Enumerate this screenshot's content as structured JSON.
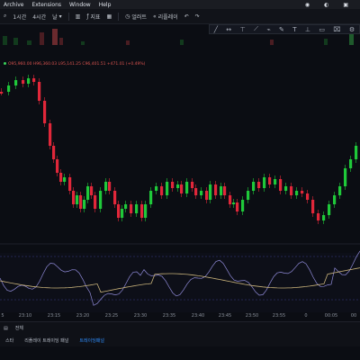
{
  "menubar": {
    "items": [
      "Archive",
      "Extensions",
      "Window",
      "Help"
    ]
  },
  "toolbar": {
    "interval": "1시간",
    "timeframe": "4시간",
    "chart_type": "날",
    "indicators": "지표",
    "alert": "얼러트",
    "replay": "리플레이"
  },
  "legend": {
    "values": "O95,960.00 H96,360.03 L95,141.25 C96,401.51 +471.01 (+0.49%)"
  },
  "xaxis": {
    "ticks": [
      "5",
      "23:10",
      "23:15",
      "23:20",
      "23:25",
      "23:30",
      "23:35",
      "23:40",
      "23:45",
      "23:50",
      "23:55",
      "0",
      "00:05",
      "00"
    ]
  },
  "bottombar": {
    "range_label": "전체"
  },
  "tabs": {
    "items": [
      "스타",
      "리플레이 트레이딩 패널",
      "트레이딩패널"
    ],
    "active_index": 2
  },
  "colors": {
    "up": "#1fc93a",
    "down": "#e1273a",
    "oscillator": "#8f8ad8",
    "signal": "#c8b27a",
    "background": "#0b0d13"
  },
  "chart_data": {
    "type": "candlestick",
    "candles_note": "",
    "candles": [
      {
        "o": 120,
        "c": 112,
        "h": 124,
        "l": 108
      },
      {
        "o": 112,
        "c": 100,
        "h": 114,
        "l": 96
      },
      {
        "o": 100,
        "c": 92,
        "h": 104,
        "l": 88
      },
      {
        "o": 92,
        "c": 98,
        "h": 102,
        "l": 88
      },
      {
        "o": 98,
        "c": 94,
        "h": 100,
        "l": 90
      },
      {
        "o": 94,
        "c": 108,
        "h": 110,
        "l": 92
      },
      {
        "o": 108,
        "c": 124,
        "h": 128,
        "l": 104
      },
      {
        "o": 124,
        "c": 136,
        "h": 140,
        "l": 120
      },
      {
        "o": 136,
        "c": 156,
        "h": 160,
        "l": 134
      },
      {
        "o": 156,
        "c": 160,
        "h": 164,
        "l": 150
      },
      {
        "o": 160,
        "c": 168,
        "h": 170,
        "l": 154
      },
      {
        "o": 168,
        "c": 196,
        "h": 204,
        "l": 166
      },
      {
        "o": 196,
        "c": 222,
        "h": 226,
        "l": 194
      },
      {
        "o": 222,
        "c": 230,
        "h": 234,
        "l": 218
      },
      {
        "o": 230,
        "c": 238,
        "h": 240,
        "l": 226
      }
    ],
    "oscillator": []
  }
}
